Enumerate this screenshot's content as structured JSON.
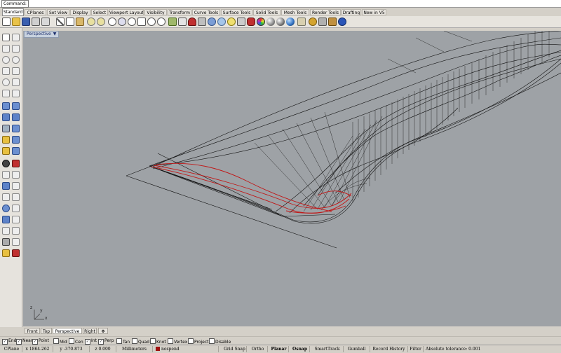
{
  "command": {
    "label": "Command:"
  },
  "tabs": [
    {
      "label": "Standard",
      "active": true
    },
    {
      "label": "CPlanes"
    },
    {
      "label": "Set View"
    },
    {
      "label": "Display"
    },
    {
      "label": "Select"
    },
    {
      "label": "Viewport Layout"
    },
    {
      "label": "Visibility"
    },
    {
      "label": "Transform"
    },
    {
      "label": "Curve Tools"
    },
    {
      "label": "Surface Tools"
    },
    {
      "label": "Solid Tools"
    },
    {
      "label": "Mesh Tools"
    },
    {
      "label": "Render Tools"
    },
    {
      "label": "Drafting"
    },
    {
      "label": "New in V5"
    }
  ],
  "toolbar_icons": [
    "new-icon",
    "open-icon",
    "save-icon",
    "print-icon",
    "import-icon",
    "cut-icon",
    "copy-icon",
    "paste-icon",
    "undo-icon",
    "redo-icon",
    "pan-icon",
    "rotate-view-icon",
    "zoom-icon",
    "zoom-window-icon",
    "zoom-extents-icon",
    "zoom-selected-icon",
    "cplane-icon",
    "viewport-layout-icon",
    "grid-icon",
    "set-view-icon",
    "shaded-icon",
    "rendered-icon",
    "capsule-icon",
    "lights-icon",
    "bulb-icon",
    "layer-icon",
    "properties-icon",
    "color-wheel-icon",
    "material-ball-icon",
    "render-sphere-icon",
    "environment-sphere-icon",
    "options-gear-icon",
    "tools-icon",
    "help-icon"
  ],
  "viewport": {
    "name": "Perspective",
    "axis": {
      "x": "x",
      "y": "y",
      "z": "z"
    }
  },
  "view_tabs": [
    {
      "label": "Front"
    },
    {
      "label": "Top"
    },
    {
      "label": "Perspective",
      "active": true
    },
    {
      "label": "Right"
    },
    {
      "label": "✥"
    }
  ],
  "osnaps": [
    {
      "label": "End",
      "checked": true
    },
    {
      "label": "Near",
      "checked": true
    },
    {
      "label": "Point",
      "checked": true
    },
    {
      "label": "Mid",
      "checked": false
    },
    {
      "label": "Cen",
      "checked": false
    },
    {
      "label": "Int",
      "checked": true
    },
    {
      "label": "Perp",
      "checked": true
    },
    {
      "label": "Tan",
      "checked": false
    },
    {
      "label": "Quad",
      "checked": false
    },
    {
      "label": "Knot",
      "checked": false
    },
    {
      "label": "Vertex",
      "checked": false
    },
    {
      "label": "Project",
      "checked": false
    },
    {
      "label": "Disable",
      "checked": false
    }
  ],
  "status": {
    "cplane": "CPlane",
    "x": "x 1864.262",
    "y": "y -370.873",
    "z": "z 0.000",
    "units": "Millimeters",
    "layer": "nospend",
    "grid_snap": "Grid Snap",
    "ortho": "Ortho",
    "planar": "Planar",
    "osnap": "Osnap",
    "smarttrack": "SmartTrack",
    "gumball": "Gumball",
    "record_history": "Record History",
    "filter": "Filter",
    "tolerance": "Absolute tolerance: 0.001",
    "layer_color": "#a01010"
  }
}
